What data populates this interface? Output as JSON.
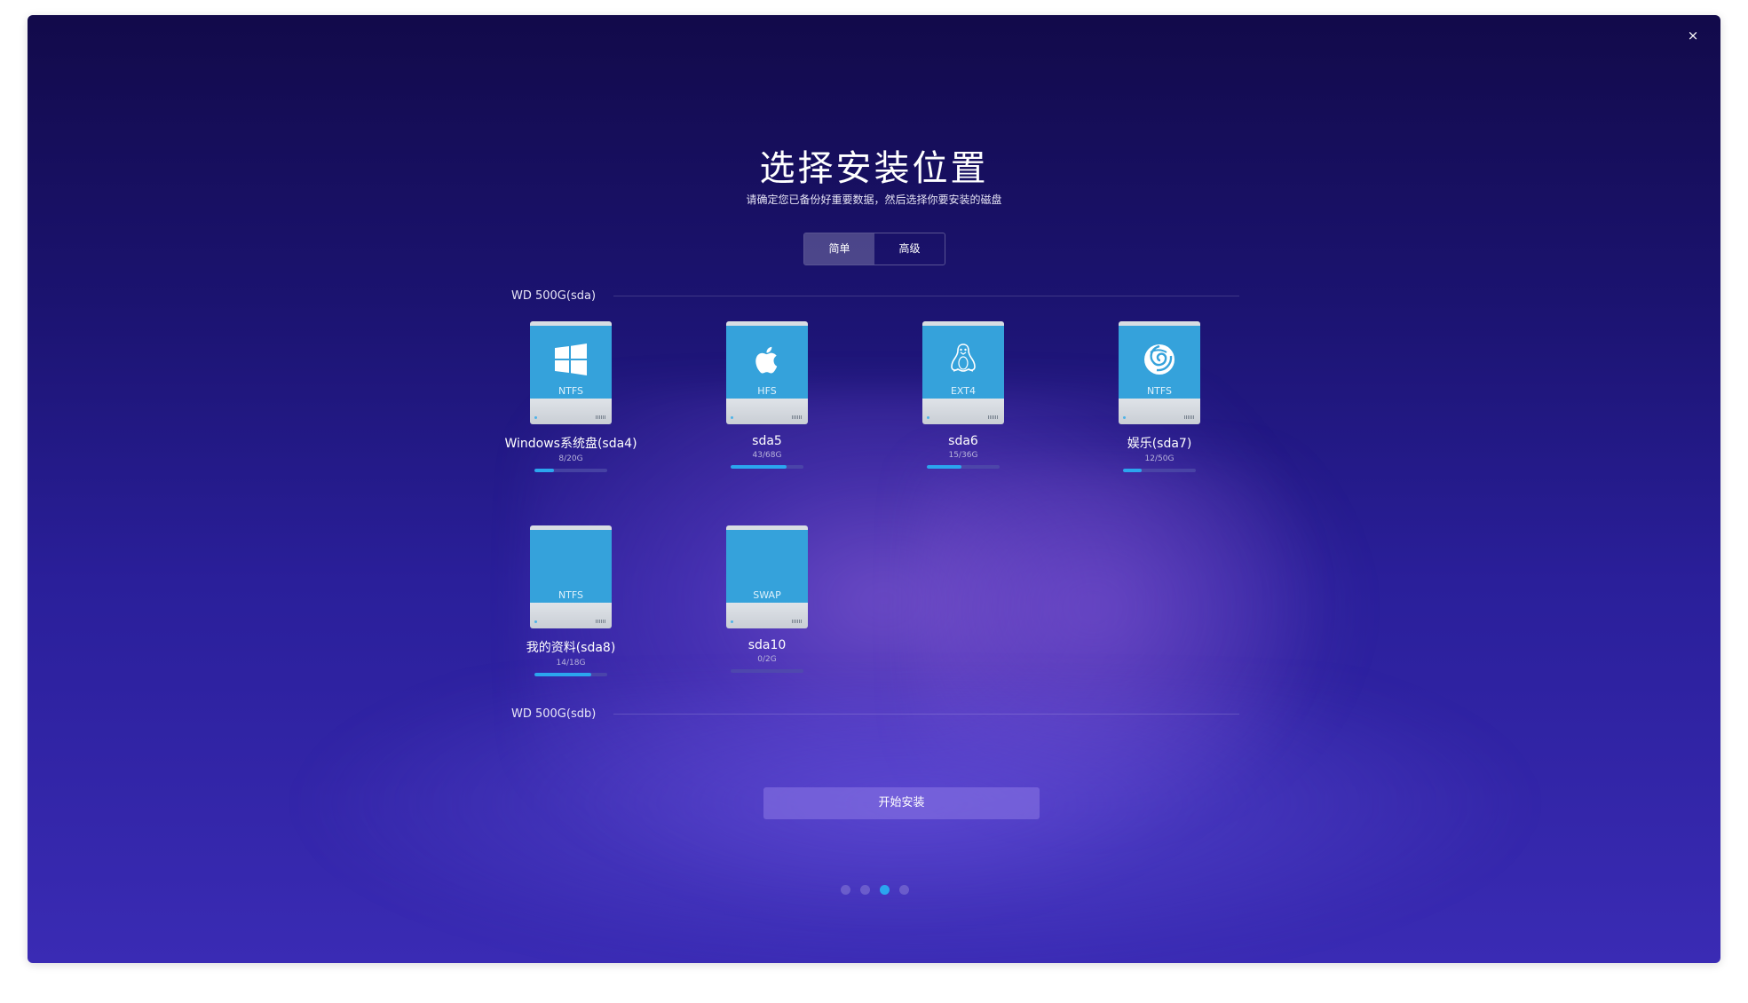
{
  "window": {
    "close_label": "×",
    "title": "选择安装位置",
    "subtitle": "请确定您已备份好重要数据，然后选择你要安装的磁盘"
  },
  "mode_toggle": {
    "simple": "简单",
    "advanced": "高级",
    "active": "simple"
  },
  "disks": [
    {
      "name": "WD 500G(sda)",
      "partitions": [
        {
          "name": "Windows系统盘(sda4)",
          "fs": "NTFS",
          "usage": "8/20G",
          "used_fraction": 0.27,
          "icon": "windows-icon"
        },
        {
          "name": "sda5",
          "fs": "HFS",
          "usage": "43/68G",
          "used_fraction": 0.77,
          "icon": "apple-icon"
        },
        {
          "name": "sda6",
          "fs": "EXT4",
          "usage": "15/36G",
          "used_fraction": 0.47,
          "icon": "linux-tux-icon"
        },
        {
          "name": "娱乐(sda7)",
          "fs": "NTFS",
          "usage": "12/50G",
          "used_fraction": 0.26,
          "icon": "deepin-icon"
        },
        {
          "name": "我的资料(sda8)",
          "fs": "NTFS",
          "usage": "14/18G",
          "used_fraction": 0.78,
          "icon": ""
        },
        {
          "name": "sda10",
          "fs": "SWAP",
          "usage": "0/2G",
          "used_fraction": 0.0,
          "icon": ""
        }
      ]
    },
    {
      "name": "WD 500G(sdb)",
      "partitions": []
    }
  ],
  "start_button": "开始安装",
  "pagination": {
    "total": 4,
    "current": 3
  },
  "colors": {
    "accent": "#2ba6ef",
    "drive_face": "#35a2db",
    "background_top": "#120a4a",
    "background_bottom": "#3a2bb4"
  }
}
